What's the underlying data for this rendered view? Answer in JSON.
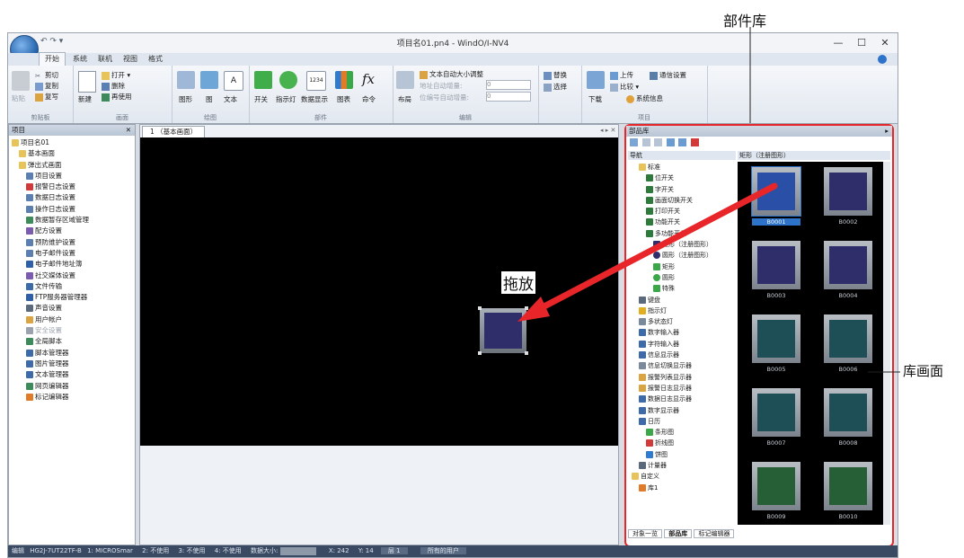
{
  "window": {
    "title": "项目名01.pn4 - WindO/I-NV4",
    "minimize_icon": "minimize-icon",
    "maximize_icon": "maximize-icon",
    "close_icon": "close-icon"
  },
  "ribbon_tabs": [
    "开始",
    "系统",
    "联机",
    "视图",
    "格式"
  ],
  "ribbon": {
    "clipboard": {
      "label": "剪贴板",
      "paste": "粘贴",
      "cut": "剪切",
      "copy": "复制",
      "format": "复写"
    },
    "screen": {
      "label": "画面",
      "new": "新建",
      "open": "打开",
      "delete": "删除",
      "reuse": "再使用"
    },
    "drawing": {
      "label": "绘图",
      "shape": "图形",
      "image": "图",
      "text": "文本"
    },
    "parts": {
      "label": "部件",
      "switch": "开关",
      "lamp": "指示灯",
      "data": "数据显示",
      "chart": "图表",
      "command": "命令"
    },
    "edit": {
      "label": "编辑",
      "text_auto": "文本自动大小调整",
      "layout": "布局",
      "addr_inc": "地址自动增量:",
      "addr_val": "0",
      "num_inc": "位编号自动增量:",
      "num_val": "0"
    },
    "find": {
      "replace": "替换",
      "select": "选择"
    },
    "project": {
      "label": "项目",
      "download": "下载",
      "upload": "上传",
      "compare": "比较",
      "comm": "通信设置",
      "sysinfo": "系统信息"
    }
  },
  "project_pane": {
    "title": "项目",
    "tree": [
      "项目名01",
      "基本画面",
      "弹出式画面",
      "项目设置",
      "报警日志设置",
      "数据日志设置",
      "操作日志设置",
      "数据暂存区域管理",
      "配方设置",
      "预防维护设置",
      "电子邮件设置",
      "电子邮件地址簿",
      "社交媒体设置",
      "文件传输",
      "FTP服务器管理器",
      "声音设置",
      "用户帐户",
      "安全设置",
      "全局脚本",
      "脚本管理器",
      "图片管理器",
      "文本管理器",
      "网页编辑器",
      "标记编辑器"
    ]
  },
  "editor": {
    "tab": "1 （基本画面）"
  },
  "library_pane": {
    "title": "部品库",
    "nav_header": "导航",
    "list_header": "矩形（注册图形）",
    "tree": [
      "标准",
      "位开关",
      "字开关",
      "画面切换开关",
      "打印开关",
      "功能开关",
      "多功能开关",
      "矩形（注册图形）",
      "圆形（注册图形）",
      "矩形",
      "圆形",
      "特殊",
      "键盘",
      "指示灯",
      "多状态灯",
      "数字输入器",
      "字符输入器",
      "信息显示器",
      "信息切换显示器",
      "报警列表显示器",
      "报警日志显示器",
      "数据日志显示器",
      "数字显示器",
      "日历",
      "条形图",
      "折线图",
      "饼图",
      "计量器",
      "自定义",
      "库1"
    ],
    "tiles": [
      "B0001",
      "B0002",
      "B0003",
      "B0004",
      "B0005",
      "B0006",
      "B0007",
      "B0008",
      "B0009",
      "B0010"
    ],
    "bottom_tabs": [
      "对象一览",
      "部品库",
      "标记编辑器"
    ]
  },
  "statusbar": {
    "mode": "编辑",
    "model": "HG2J-7UT22TF-B",
    "p1": "1: MICROSmar",
    "p2": "2: 不使用",
    "p3": "3: 不使用",
    "p4": "4: 不使用",
    "size": "数据大小:",
    "x": "X: 242",
    "y": "Y: 14",
    "layer": "层 1",
    "users": "所有的用户"
  },
  "annotations": {
    "parts_library": "部件库",
    "drag_drop": "拖放",
    "library_screen": "库画面"
  },
  "colors": {
    "accent": "#e8262a",
    "tile_blue": "#2f2e6a",
    "tile_teal": "#1f4f56",
    "tile_green": "#265e36",
    "selected": "#2c73c9"
  }
}
